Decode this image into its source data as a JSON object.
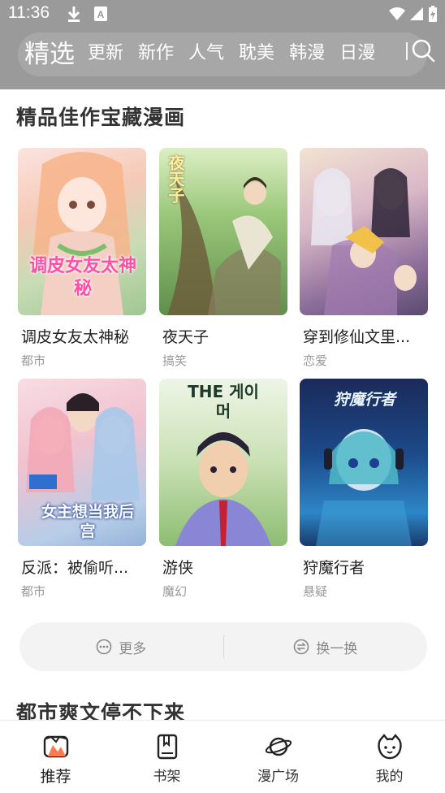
{
  "status_bar": {
    "time": "11:36"
  },
  "nav": {
    "tabs": [
      "精选",
      "更新",
      "新作",
      "人气",
      "耽美",
      "韩漫",
      "日漫"
    ]
  },
  "section1": {
    "title": "精品佳作宝藏漫画",
    "items": [
      {
        "title": "调皮女友太神秘",
        "tag": "都市",
        "cover_text": "调皮女友太神秘"
      },
      {
        "title": "夜天子",
        "tag": "搞笑",
        "cover_text": "夜天子"
      },
      {
        "title": "穿到修仙文里...",
        "tag": "恋爱",
        "cover_text": ""
      },
      {
        "title": "反派：被偷听...",
        "tag": "都市",
        "cover_text": "女主想当我后宫"
      },
      {
        "title": "游侠",
        "tag": "魔幻",
        "cover_text": "THE 게이머"
      },
      {
        "title": "狩魔行者",
        "tag": "悬疑",
        "cover_text": "狩魔行者"
      }
    ],
    "more_label": "更多",
    "refresh_label": "换一换"
  },
  "section2": {
    "title": "都市爽文停不下来"
  },
  "bottom_nav": {
    "items": [
      "推荐",
      "书架",
      "漫广场",
      "我的"
    ]
  },
  "colors": {
    "header_gray": "#9a9a9a",
    "accent": "#ff8a65"
  }
}
